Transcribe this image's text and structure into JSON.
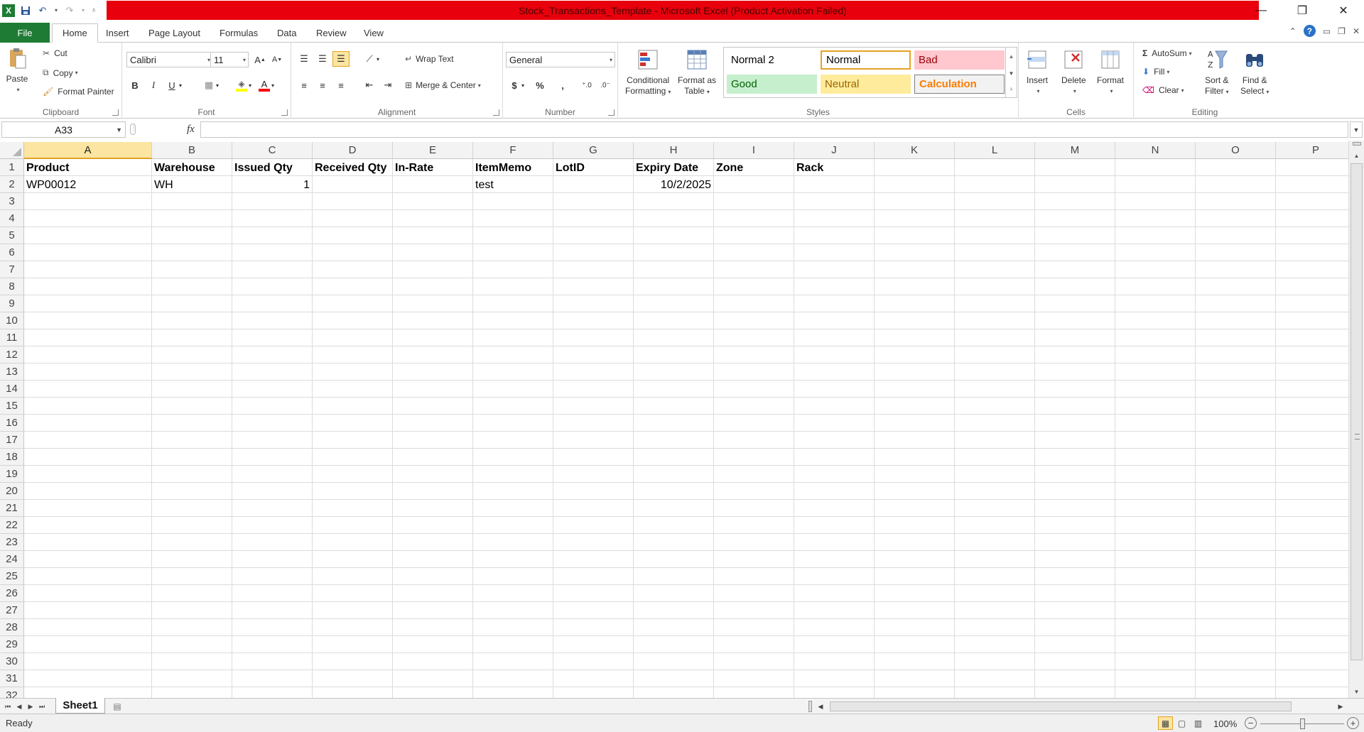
{
  "window": {
    "title": "Stock_Transactions_Template  -  Microsoft Excel (Product Activation Failed)"
  },
  "tabs": [
    "File",
    "Home",
    "Insert",
    "Page Layout",
    "Formulas",
    "Data",
    "Review",
    "View"
  ],
  "ribbon": {
    "clipboard": {
      "label": "Clipboard",
      "paste": "Paste",
      "cut": "Cut",
      "copy": "Copy",
      "format_painter": "Format Painter"
    },
    "font": {
      "label": "Font",
      "family": "Calibri",
      "size": "11",
      "bold": "B",
      "italic": "I",
      "underline": "U"
    },
    "alignment": {
      "label": "Alignment",
      "wrap_text": "Wrap Text",
      "merge_center": "Merge & Center"
    },
    "number": {
      "label": "Number",
      "format": "General",
      "currency": "$",
      "percent": "%",
      "comma": ","
    },
    "styles": {
      "label": "Styles",
      "conditional_formatting": [
        "Conditional",
        "Formatting"
      ],
      "format_as_table": [
        "Format as",
        "Table"
      ],
      "cells": [
        {
          "name": "Normal 2",
          "bg": "#ffffff",
          "fg": "#000000"
        },
        {
          "name": "Normal",
          "bg": "#ffffff",
          "fg": "#000000"
        },
        {
          "name": "Bad",
          "bg": "#ffc7ce",
          "fg": "#9c0006"
        },
        {
          "name": "Good",
          "bg": "#c6efce",
          "fg": "#006100"
        },
        {
          "name": "Neutral",
          "bg": "#ffeb9c",
          "fg": "#9c6500"
        },
        {
          "name": "Calculation",
          "bg": "#f2f2f2",
          "fg": "#fa7d00"
        }
      ]
    },
    "cells": {
      "label": "Cells",
      "insert": "Insert",
      "delete": "Delete",
      "format": "Format"
    },
    "editing": {
      "label": "Editing",
      "autosum": "AutoSum",
      "fill": "Fill",
      "clear": "Clear",
      "sort_filter": [
        "Sort &",
        "Filter"
      ],
      "find_select": [
        "Find &",
        "Select"
      ]
    }
  },
  "formula_bar": {
    "name_box": "A33",
    "fx": "fx",
    "formula": ""
  },
  "sheet": {
    "columns": [
      "A",
      "B",
      "C",
      "D",
      "E",
      "F",
      "G",
      "H",
      "I",
      "J",
      "K",
      "L",
      "M",
      "N",
      "O",
      "P"
    ],
    "selected_column": "A",
    "rows": [
      "1",
      "2",
      "3",
      "4",
      "5",
      "6",
      "7",
      "8",
      "9",
      "10",
      "11",
      "12",
      "13",
      "14",
      "15",
      "16",
      "17",
      "18",
      "19",
      "20",
      "21",
      "22",
      "23",
      "24",
      "25",
      "26",
      "27",
      "28",
      "29",
      "30",
      "31",
      "32"
    ],
    "header_row": [
      "Product",
      "Warehouse",
      "Issued Qty",
      "Received Qty",
      "In-Rate",
      "ItemMemo",
      "LotID",
      "Expiry Date",
      "Zone",
      "Rack"
    ],
    "data_row": [
      "WP00012",
      "WH",
      "1",
      "",
      "",
      "test",
      "",
      "10/2/2025",
      "",
      ""
    ]
  },
  "sheet_tabs": [
    "Sheet1"
  ],
  "status": {
    "text": "Ready",
    "zoom": "100%"
  },
  "colors": {
    "title_bar": "#e8000c",
    "file_tab": "#1e7b34",
    "selected_header": "#fbe5a0"
  }
}
